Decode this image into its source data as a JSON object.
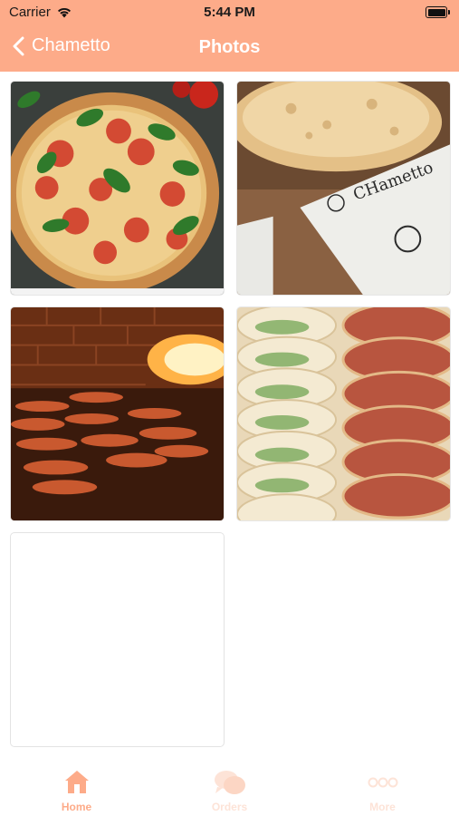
{
  "status_bar": {
    "carrier": "Carrier",
    "time": "5:44 PM"
  },
  "nav": {
    "back_label": "Chametto",
    "title": "Photos"
  },
  "colors": {
    "accent": "#fdab89",
    "accent_light": "#fde3d7"
  },
  "photos": [
    {
      "subject": "margherita pizza with tomato and basil"
    },
    {
      "subject": "flatbread on Chametto branded paper"
    },
    {
      "subject": "brick oven with flatbreads baking"
    },
    {
      "subject": "spinach and meat manakish pies"
    },
    {
      "subject": "empty"
    }
  ],
  "tabs": [
    {
      "label": "Home",
      "icon": "home-icon",
      "active": true
    },
    {
      "label": "Orders",
      "icon": "chat-bubbles-icon",
      "active": false
    },
    {
      "label": "More",
      "icon": "more-dots-icon",
      "active": false
    }
  ]
}
